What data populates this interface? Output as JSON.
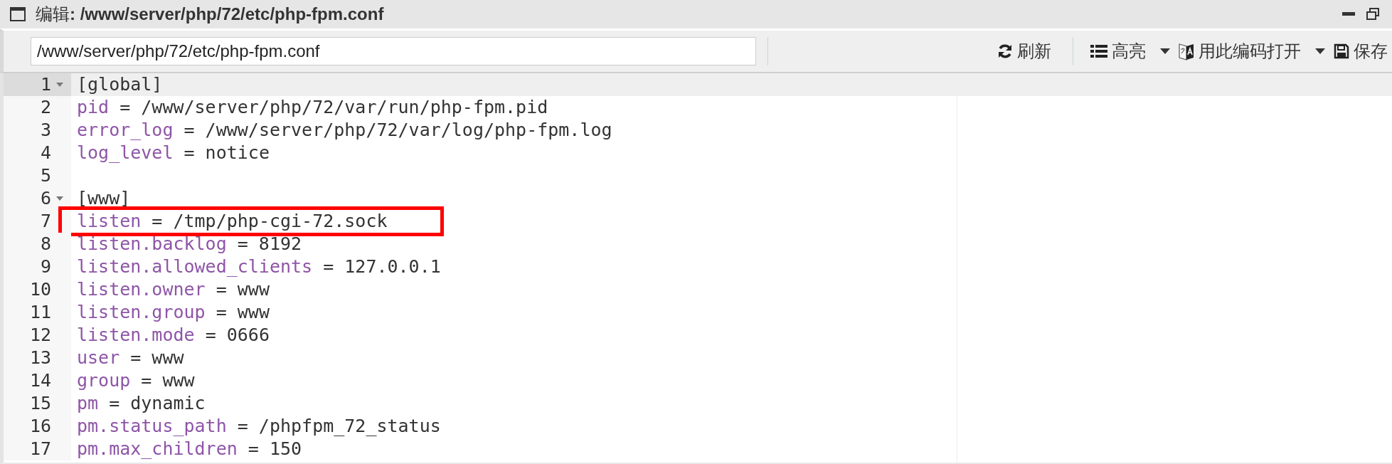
{
  "window": {
    "title": "编辑**: /www/server/php/72/etc/php-fpm.conf**"
  },
  "toolbar": {
    "path_field": {
      "value": "/www/server/php/72/etc/php-fpm.conf"
    },
    "buttons": [
      {
        "kind": "refresh",
        "label": "刷新",
        "dropdown": false
      },
      {
        "kind": "highlight",
        "label": "高亮",
        "dropdown": true
      },
      {
        "kind": "encoding",
        "label": "用此编码打开",
        "dropdown": true
      },
      {
        "kind": "save",
        "label": "保存",
        "dropdown": false
      }
    ]
  },
  "editor": {
    "lines": [
      {
        "number": "1",
        "kind": "section",
        "text": "[global]",
        "foldable": true,
        "active": true,
        "boxed": false
      },
      {
        "number": "2",
        "kind": "pair",
        "key": "pid",
        "rest": " = /www/server/php/72/var/run/php-fpm.pid",
        "foldable": false,
        "active": false,
        "boxed": false
      },
      {
        "number": "3",
        "kind": "pair",
        "key": "error_log",
        "rest": " = /www/server/php/72/var/log/php-fpm.log",
        "foldable": false,
        "active": false,
        "boxed": false
      },
      {
        "number": "4",
        "kind": "pair",
        "key": "log_level",
        "rest": " = notice",
        "foldable": false,
        "active": false,
        "boxed": false
      },
      {
        "number": "5",
        "kind": "blank",
        "foldable": false,
        "active": false,
        "boxed": false
      },
      {
        "number": "6",
        "kind": "section",
        "text": "[www]",
        "foldable": true,
        "active": false,
        "boxed": false
      },
      {
        "number": "7",
        "kind": "pair",
        "key": "listen",
        "rest": " = /tmp/php-cgi-72.sock",
        "foldable": false,
        "active": false,
        "boxed": true
      },
      {
        "number": "8",
        "kind": "pair",
        "key": "listen.backlog",
        "rest": " = 8192",
        "foldable": false,
        "active": false,
        "boxed": false
      },
      {
        "number": "9",
        "kind": "pair",
        "key": "listen.allowed_clients",
        "rest": " = 127.0.0.1",
        "foldable": false,
        "active": false,
        "boxed": false
      },
      {
        "number": "10",
        "kind": "pair",
        "key": "listen.owner",
        "rest": " = www",
        "foldable": false,
        "active": false,
        "boxed": false
      },
      {
        "number": "11",
        "kind": "pair",
        "key": "listen.group",
        "rest": " = www",
        "foldable": false,
        "active": false,
        "boxed": false
      },
      {
        "number": "12",
        "kind": "pair",
        "key": "listen.mode",
        "rest": " = 0666",
        "foldable": false,
        "active": false,
        "boxed": false
      },
      {
        "number": "13",
        "kind": "pair",
        "key": "user",
        "rest": " = www",
        "foldable": false,
        "active": false,
        "boxed": false
      },
      {
        "number": "14",
        "kind": "pair",
        "key": "group",
        "rest": " = www",
        "foldable": false,
        "active": false,
        "boxed": false
      },
      {
        "number": "15",
        "kind": "pair",
        "key": "pm",
        "rest": " = dynamic",
        "foldable": false,
        "active": false,
        "boxed": false
      },
      {
        "number": "16",
        "kind": "pair",
        "key": "pm.status_path",
        "rest": " = /phpfpm_72_status",
        "foldable": false,
        "active": false,
        "boxed": false
      },
      {
        "number": "17",
        "kind": "pair",
        "key": "pm.max_children",
        "rest": " = 150",
        "foldable": false,
        "active": false,
        "boxed": false
      }
    ]
  }
}
